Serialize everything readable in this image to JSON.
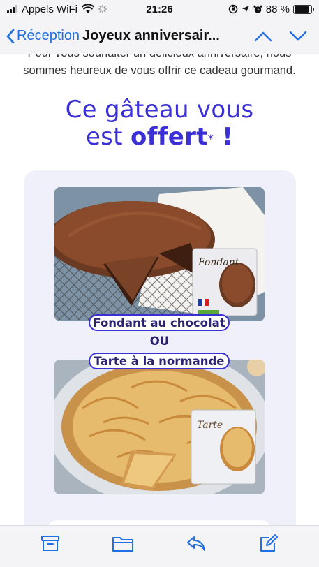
{
  "status_bar": {
    "carrier": "Appels WiFi",
    "time": "21:26",
    "battery_percent": "88 %",
    "battery_level": 0.88
  },
  "nav": {
    "back_label": "Réception",
    "title": "Joyeux anniversair...",
    "accent_color": "#1f6fe5"
  },
  "email": {
    "intro_line1": "Pour vous souhaiter un délicieux anniversaire, nous",
    "intro_line2": "sommes heureux de vous offrir ce cadeau gourmand.",
    "headline_line1": "Ce gâteau vous",
    "headline_est": "est ",
    "headline_offert": "offert",
    "headline_asterisk": "*",
    "headline_exclaim": " !",
    "brand_color": "#3b2fd6",
    "option1": "Fondant au chocolat",
    "or_label": "OU",
    "option2": "Tarte à la normande",
    "box1_label": "Fondant",
    "box2_label": "Tarte"
  },
  "toolbar": {
    "icons": [
      "archive-icon",
      "folder-icon",
      "reply-icon",
      "compose-icon"
    ]
  }
}
